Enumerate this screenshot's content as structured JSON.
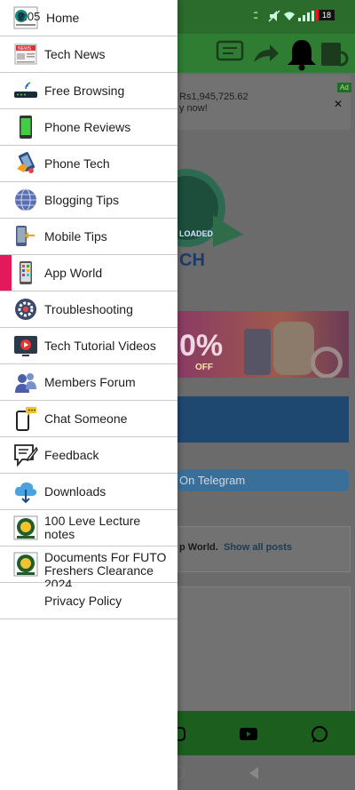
{
  "status": {
    "time": "2:05",
    "battery": "18"
  },
  "background": {
    "ad_text_line1": "Rs1,945,725.62",
    "ad_text_line2": "y now!",
    "ad_badge": "Ad",
    "logo_text": "LOADED",
    "logo_text2": "CH",
    "banner_text": "0%",
    "banner_sub": "OFF",
    "telegram_text": "On Telegram",
    "card_text": "p World.",
    "card_link": "Show all posts"
  },
  "drawer": {
    "items": [
      {
        "label": "Home",
        "icon": "home-icon"
      },
      {
        "label": "Tech News",
        "icon": "news-icon"
      },
      {
        "label": "Free Browsing",
        "icon": "router-icon"
      },
      {
        "label": "Phone Reviews",
        "icon": "phone-icon"
      },
      {
        "label": "Phone Tech",
        "icon": "phone-tech-icon"
      },
      {
        "label": "Blogging Tips",
        "icon": "globe-icon"
      },
      {
        "label": "Mobile Tips",
        "icon": "mobile-tips-icon"
      },
      {
        "label": "App World",
        "icon": "app-grid-icon"
      },
      {
        "label": "Troubleshooting",
        "icon": "gear-icon"
      },
      {
        "label": "Tech Tutorial Videos",
        "icon": "video-icon"
      },
      {
        "label": "Members Forum",
        "icon": "users-icon"
      },
      {
        "label": "Chat Someone",
        "icon": "chat-icon"
      },
      {
        "label": "Feedback",
        "icon": "feedback-icon"
      },
      {
        "label": "Downloads",
        "icon": "cloud-download-icon"
      },
      {
        "label": "100 Leve Lecture notes",
        "icon": "crest-icon"
      },
      {
        "label": "Documents For FUTO Freshers Clearance 2024",
        "icon": "crest-icon"
      },
      {
        "label": "Privacy Policy",
        "icon": ""
      }
    ],
    "active_index": 7
  },
  "colors": {
    "accent": "#e2195b",
    "brand_green": "#2f7d33"
  }
}
